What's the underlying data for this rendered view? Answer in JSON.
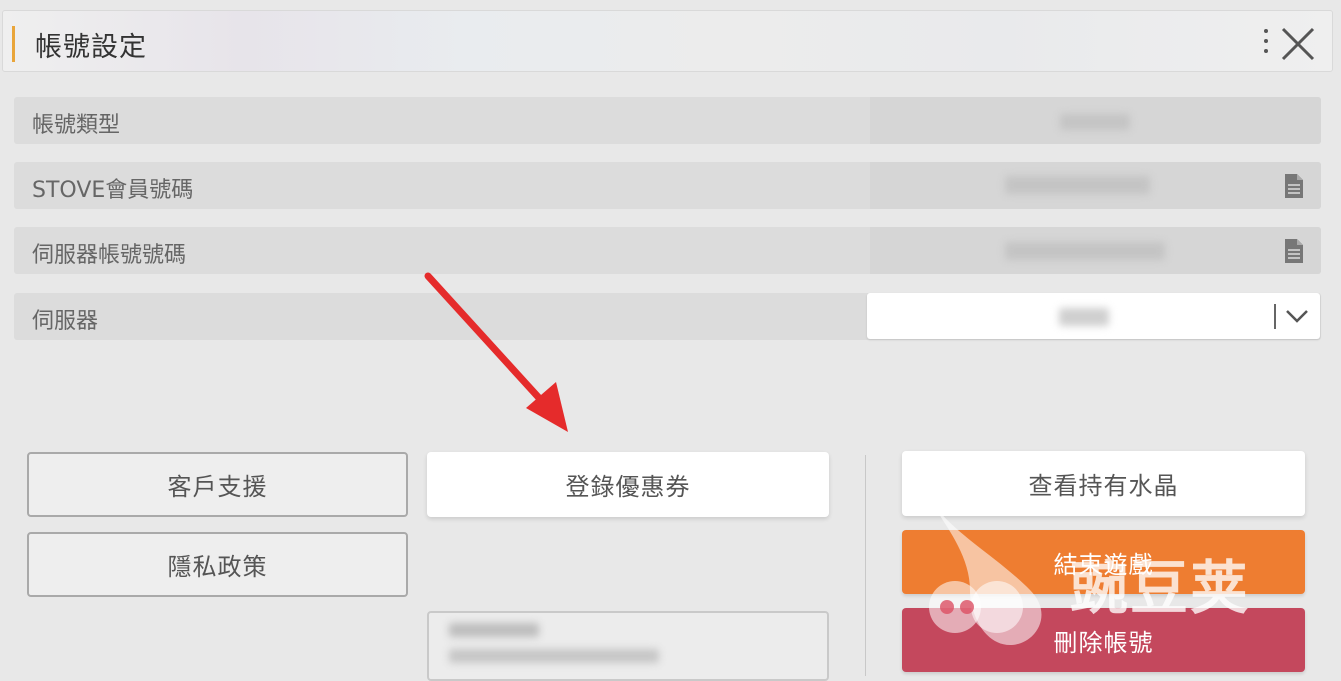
{
  "header": {
    "title": "帳號設定",
    "accent_color": "#e9a53a",
    "menu_icon": "kebab-icon",
    "close_icon": "close-icon"
  },
  "rows": [
    {
      "label": "帳號類型",
      "has_copy": false
    },
    {
      "label": "STOVE會員號碼",
      "has_copy": true
    },
    {
      "label": "伺服器帳號號碼",
      "has_copy": true
    },
    {
      "label": "伺服器",
      "has_copy": false
    }
  ],
  "buttons": {
    "support": "客戶支援",
    "privacy": "隱私政策",
    "coupon": "登錄優惠券",
    "crystals": "查看持有水晶",
    "end_game": "結束遊戲",
    "delete_account": "刪除帳號"
  },
  "colors": {
    "orange": "#ee7d31",
    "red": "#c4485d",
    "arrow": "#e52b2b"
  },
  "watermark": {
    "text": "豌豆荚"
  }
}
